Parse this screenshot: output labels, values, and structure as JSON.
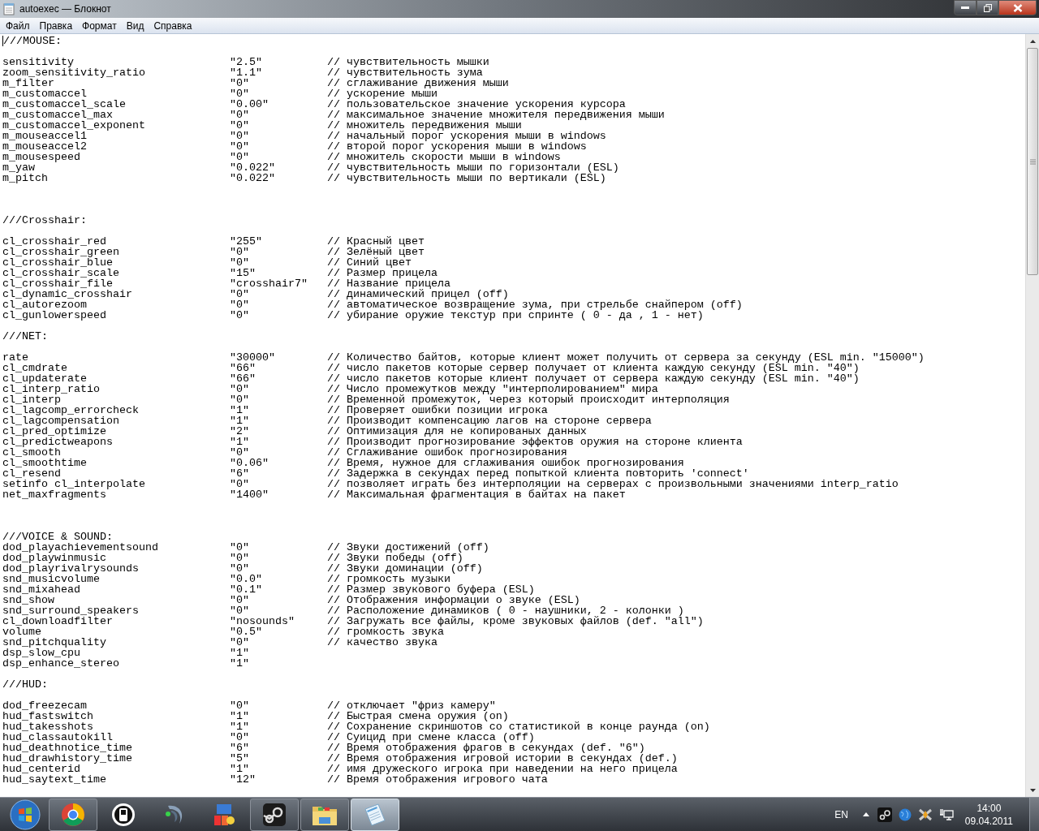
{
  "window": {
    "title": "autoexec — Блокнот"
  },
  "menu": [
    "Файл",
    "Правка",
    "Формат",
    "Вид",
    "Справка"
  ],
  "document": {
    "lines": [
      {
        "kind": "header",
        "text": "///MOUSE:"
      },
      {
        "kind": "blank"
      },
      {
        "kind": "setting",
        "name": "sensitivity",
        "value": "\"2.5\"",
        "comment": "// чувствительность мышки"
      },
      {
        "kind": "setting",
        "name": "zoom_sensitivity_ratio",
        "value": "\"1.1\"",
        "comment": "// чувствительность зума"
      },
      {
        "kind": "setting",
        "name": "m_filter",
        "value": "\"0\"",
        "comment": "// сглаживание движения мыши"
      },
      {
        "kind": "setting",
        "name": "m_customaccel",
        "value": "\"0\"",
        "comment": "// ускорение мыши"
      },
      {
        "kind": "setting",
        "name": "m_customaccel_scale",
        "value": "\"0.00\"",
        "comment": "// пользовательское значение ускорения курсора"
      },
      {
        "kind": "setting",
        "name": "m_customaccel_max",
        "value": "\"0\"",
        "comment": "// максимальное значение множителя передвижения мыши"
      },
      {
        "kind": "setting",
        "name": "m_customaccel_exponent",
        "value": "\"0\"",
        "comment": "// множитель передвижения мыши"
      },
      {
        "kind": "setting",
        "name": "m_mouseaccel1",
        "value": "\"0\"",
        "comment": "// начальный порог ускорения мыши в windows"
      },
      {
        "kind": "setting",
        "name": "m_mouseaccel2",
        "value": "\"0\"",
        "comment": "// второй порог ускорения мыши в windows"
      },
      {
        "kind": "setting",
        "name": "m_mousespeed",
        "value": "\"0\"",
        "comment": "// множитель скорости мыши в windows"
      },
      {
        "kind": "setting",
        "name": "m_yaw",
        "value": "\"0.022\"",
        "comment": "// чувствительность мыши по горизонтали (ESL)"
      },
      {
        "kind": "setting",
        "name": "m_pitch",
        "value": "\"0.022\"",
        "comment": "// чувствительность мыши по вертикали (ESL)"
      },
      {
        "kind": "blank"
      },
      {
        "kind": "blank"
      },
      {
        "kind": "blank"
      },
      {
        "kind": "header",
        "text": "///Crosshair:"
      },
      {
        "kind": "blank"
      },
      {
        "kind": "setting",
        "name": "cl_crosshair_red",
        "value": "\"255\"",
        "comment": "// Красный цвет"
      },
      {
        "kind": "setting",
        "name": "cl_crosshair_green",
        "value": "\"0\"",
        "comment": "// Зелёный цвет"
      },
      {
        "kind": "setting",
        "name": "cl_crosshair_blue",
        "value": "\"0\"",
        "comment": "// Синий цвет"
      },
      {
        "kind": "setting",
        "name": "cl_crosshair_scale",
        "value": "\"15\"",
        "comment": "// Размер прицела"
      },
      {
        "kind": "setting",
        "name": "cl_crosshair_file",
        "value": "\"crosshair7\"",
        "comment": "// Название прицела"
      },
      {
        "kind": "setting",
        "name": "cl_dynamic_crosshair",
        "value": "\"0\"",
        "comment": "// динамический прицел (off)"
      },
      {
        "kind": "setting",
        "name": "cl_autorezoom",
        "value": "\"0\"",
        "comment": "// автоматическое возвращение зума, при стрельбе снайпером (off)"
      },
      {
        "kind": "setting",
        "name": "cl_gunlowerspeed",
        "value": "\"0\"",
        "comment": "// убирание оружие текстур при спринте ( 0 - да , 1 - нет)"
      },
      {
        "kind": "blank"
      },
      {
        "kind": "header",
        "text": "///NET:"
      },
      {
        "kind": "blank"
      },
      {
        "kind": "setting",
        "name": "rate",
        "value": "\"30000\"",
        "comment": "// Количество байтов, которые клиент может получить от сервера за секунду (ESL min. \"15000\")"
      },
      {
        "kind": "setting",
        "name": "cl_cmdrate",
        "value": "\"66\"",
        "comment": "// число пакетов которые сервер получает от клиента каждую секунду (ESL min. \"40\")"
      },
      {
        "kind": "setting",
        "name": "cl_updaterate",
        "value": "\"66\"",
        "comment": "// число пакетов которые клиент получает от сервера каждую секунду (ESL min. \"40\")"
      },
      {
        "kind": "setting",
        "name": "cl_interp_ratio",
        "value": "\"0\"",
        "comment": "// Число промежутков между \"интерполированием\" мира"
      },
      {
        "kind": "setting",
        "name": "cl_interp",
        "value": "\"0\"",
        "comment": "// Временной промежуток, через который происходит интерполяция"
      },
      {
        "kind": "setting",
        "name": "cl_lagcomp_errorcheck",
        "value": "\"1\"",
        "comment": "// Проверяет ошибки позиции игрока"
      },
      {
        "kind": "setting",
        "name": "cl_lagcompensation",
        "value": "\"1\"",
        "comment": "// Производит компенсацию лагов на стороне сервера"
      },
      {
        "kind": "setting",
        "name": "cl_pred_optimize",
        "value": "\"2\"",
        "comment": "// Оптимизация для не копированых данных"
      },
      {
        "kind": "setting",
        "name": "cl_predictweapons",
        "value": "\"1\"",
        "comment": "// Производит прогнозирование эффектов оружия на стороне клиента"
      },
      {
        "kind": "setting",
        "name": "cl_smooth",
        "value": "\"0\"",
        "comment": "// Сглаживание ошибок прогнозирования"
      },
      {
        "kind": "setting",
        "name": "cl_smoothtime",
        "value": "\"0.06\"",
        "comment": "// Время, нужное для сглаживания ошибок прогнозирования"
      },
      {
        "kind": "setting",
        "name": "cl_resend",
        "value": "\"6\"",
        "comment": "// Задержка в секундах перед попыткой клиента повторить 'connect'"
      },
      {
        "kind": "setting",
        "name": "setinfo cl_interpolate",
        "value": "\"0\"",
        "comment": "// позволяет играть без интерполяции на серверах с произвольными значениями interp_ratio"
      },
      {
        "kind": "setting",
        "name": "net_maxfragments",
        "value": "\"1400\"",
        "comment": "// Максимальная фрагментация в байтах на пакет"
      },
      {
        "kind": "blank"
      },
      {
        "kind": "blank"
      },
      {
        "kind": "blank"
      },
      {
        "kind": "header",
        "text": "///VOICE & SOUND:"
      },
      {
        "kind": "setting",
        "name": "dod_playachievementsound",
        "value": "\"0\"",
        "comment": "// Звуки достижений (off)"
      },
      {
        "kind": "setting",
        "name": "dod_playwinmusic",
        "value": "\"0\"",
        "comment": "// Звуки победы (off)"
      },
      {
        "kind": "setting",
        "name": "dod_playrivalrysounds",
        "value": "\"0\"",
        "comment": "// Звуки доминации (off)"
      },
      {
        "kind": "setting",
        "name": "snd_musicvolume",
        "value": "\"0.0\"",
        "comment": "// громкость музыки"
      },
      {
        "kind": "setting",
        "name": "snd_mixahead",
        "value": "\"0.1\"",
        "comment": "// Размер звукового буфера (ESL)"
      },
      {
        "kind": "setting",
        "name": "snd_show",
        "value": "\"0\"",
        "comment": "// Отображения информации о звуке (ESL)"
      },
      {
        "kind": "setting",
        "name": "snd_surround_speakers",
        "value": "\"0\"",
        "comment": "// Расположение динамиков ( 0 - наушники, 2 - колонки )"
      },
      {
        "kind": "setting",
        "name": "cl_downloadfilter",
        "value": "\"nosounds\"",
        "comment": "// Загружать все файлы, кроме звуковых файлов (def. \"all\")"
      },
      {
        "kind": "setting",
        "name": "volume",
        "value": "\"0.5\"",
        "comment": "// громкость звука"
      },
      {
        "kind": "setting",
        "name": "snd_pitchquality",
        "value": "\"0\"",
        "comment": "// качество звука"
      },
      {
        "kind": "setting",
        "name": "dsp_slow_cpu",
        "value": "\"1\""
      },
      {
        "kind": "setting",
        "name": "dsp_enhance_stereo",
        "value": "\"1\""
      },
      {
        "kind": "blank"
      },
      {
        "kind": "header",
        "text": "///HUD:"
      },
      {
        "kind": "blank"
      },
      {
        "kind": "setting",
        "name": "dod_freezecam",
        "value": "\"0\"",
        "comment": "// отключает \"фриз камеру\""
      },
      {
        "kind": "setting",
        "name": "hud_fastswitch",
        "value": "\"1\"",
        "comment": "// Быстрая смена оружия (on)"
      },
      {
        "kind": "setting",
        "name": "hud_takesshots",
        "value": "\"1\"",
        "comment": "// Сохранение скриншотов со статистикой в конце раунда (on)"
      },
      {
        "kind": "setting",
        "name": "hud_classautokill",
        "value": "\"0\"",
        "comment": "// Суицид при смене класса (off)"
      },
      {
        "kind": "setting",
        "name": "hud_deathnotice_time",
        "value": "\"6\"",
        "comment": "// Время отображения фрагов в секундах (def. \"6\")"
      },
      {
        "kind": "setting",
        "name": "hud_drawhistory_time",
        "value": "\"5\"",
        "comment": "// Время отображения игровой истории в секундах (def.)"
      },
      {
        "kind": "setting",
        "name": "hud_centerid",
        "value": "\"1\"",
        "comment": "// имя дружеского игрока при наведении на него прицела"
      },
      {
        "kind": "setting",
        "name": "hud_saytext_time",
        "value": "\"12\"",
        "comment": "// Время отображения игрового чата"
      }
    ]
  },
  "taskbar": {
    "apps": [
      {
        "kind": "browser",
        "running": true,
        "selected": false
      },
      {
        "kind": "ble",
        "running": false,
        "selected": false
      },
      {
        "kind": "voice",
        "running": false,
        "selected": false
      },
      {
        "kind": "irc",
        "running": false,
        "selected": false
      },
      {
        "kind": "steam",
        "running": true,
        "selected": false
      },
      {
        "kind": "folder",
        "running": true,
        "selected": false
      },
      {
        "kind": "notepad",
        "running": true,
        "selected": true
      }
    ],
    "language": "EN",
    "time": "14:00",
    "date": "09.04.2011"
  }
}
